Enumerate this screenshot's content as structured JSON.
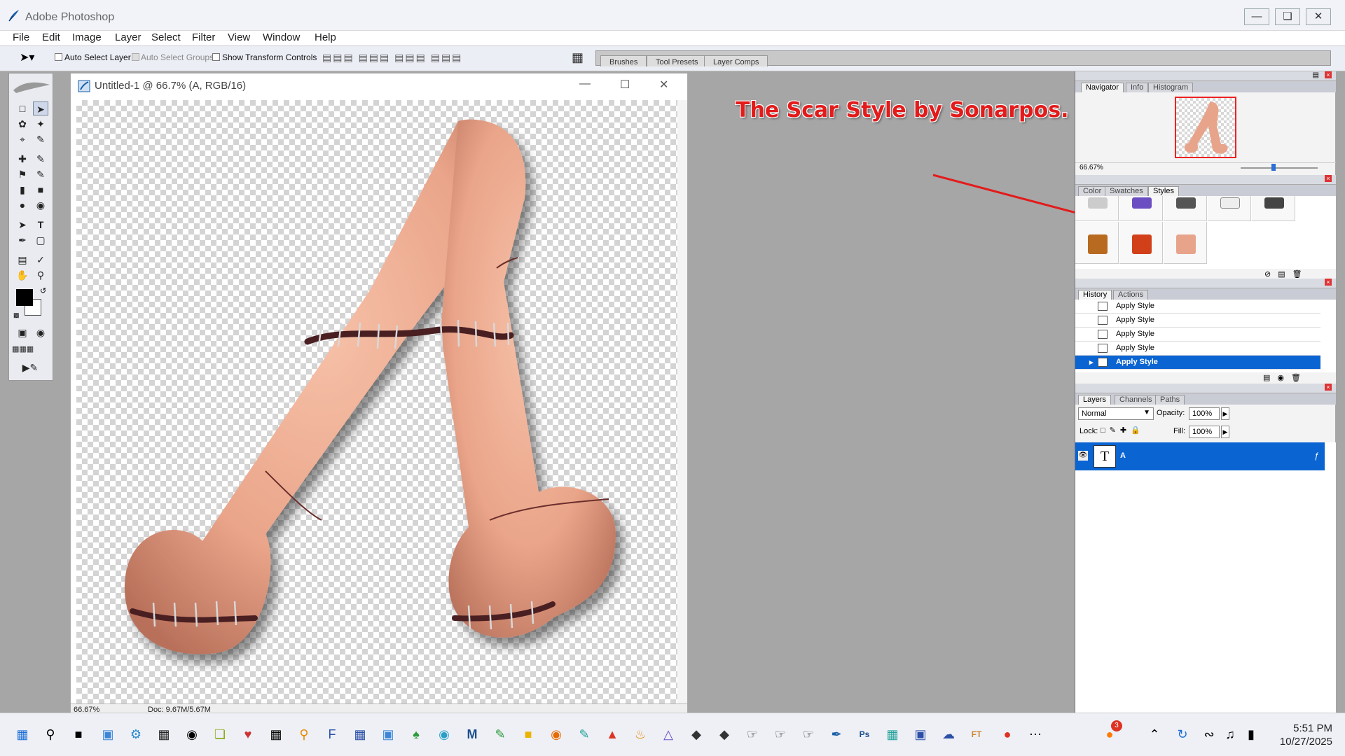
{
  "app": {
    "title": "Adobe Photoshop"
  },
  "menu": [
    "File",
    "Edit",
    "Image",
    "Layer",
    "Select",
    "Filter",
    "View",
    "Window",
    "Help"
  ],
  "options": {
    "auto_select_layer": "Auto Select Layer",
    "auto_select_groups": "Auto Select Groups",
    "show_transform_controls": "Show Transform Controls",
    "well_tabs": [
      "Brushes",
      "Tool Presets",
      "Layer Comps"
    ]
  },
  "document": {
    "title": "Untitled-1 @ 66.7% (A, RGB/16)",
    "zoom": "66.67%",
    "doc_size": "Doc: 9.67M/5.67M"
  },
  "annotation": "The Scar Style by Sonarpos.",
  "navigator": {
    "tabs": [
      "Navigator",
      "Info",
      "Histogram"
    ],
    "zoom": "66.67%"
  },
  "styles_panel": {
    "tabs": [
      "Color",
      "Swatches",
      "Styles"
    ]
  },
  "history": {
    "tabs": [
      "History",
      "Actions"
    ],
    "items": [
      "Apply Style",
      "Apply Style",
      "Apply Style",
      "Apply Style",
      "Apply Style"
    ]
  },
  "layers": {
    "tabs": [
      "Layers",
      "Channels",
      "Paths"
    ],
    "blend_mode": "Normal",
    "opacity_label": "Opacity:",
    "opacity": "100%",
    "lock_label": "Lock:",
    "fill_label": "Fill:",
    "fill": "100%",
    "layer_name": "A",
    "layer_thumb": "T"
  },
  "taskbar": {
    "badge": "3",
    "time": "5:51 PM",
    "date": "10/27/2025"
  },
  "colors": {
    "accent": "#0a64d2",
    "annotation": "#e31b1b",
    "skin": "#e8a48a"
  }
}
